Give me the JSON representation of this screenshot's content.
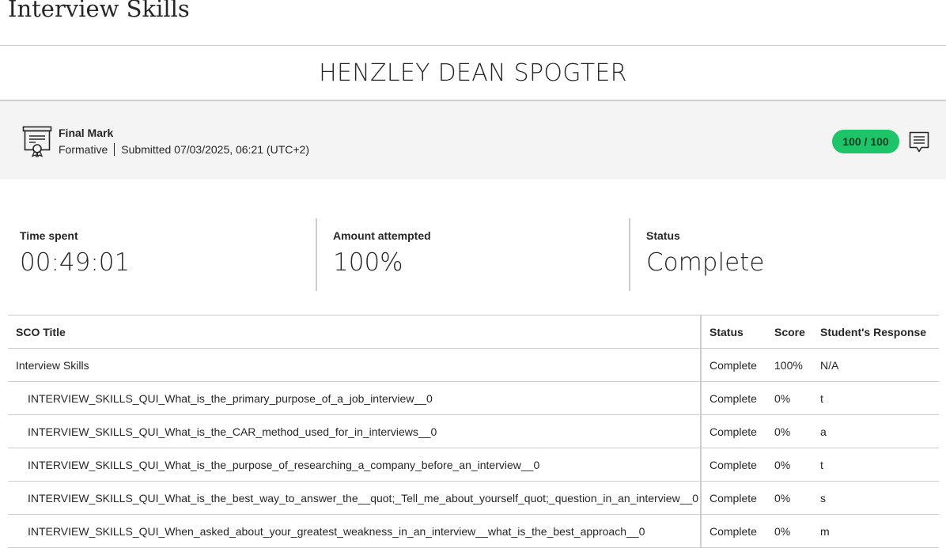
{
  "page": {
    "title": "Interview Skills"
  },
  "student": {
    "name": "HENZLEY DEAN SPOGTER"
  },
  "final_mark": {
    "label": "Final Mark",
    "type": "Formative",
    "submitted": "Submitted 07/03/2025, 06:21 (UTC+2)",
    "score": "100 / 100",
    "score_color": "#1ec568",
    "icons": [
      "certificate-icon",
      "feedback-icon"
    ]
  },
  "stats": [
    {
      "label": "Time spent",
      "value": "00:49:01"
    },
    {
      "label": "Amount attempted",
      "value": "100%"
    },
    {
      "label": "Status",
      "value": "Complete"
    }
  ],
  "table": {
    "headers": [
      "SCO Title",
      "Status",
      "Score",
      "Student's Response"
    ],
    "rows": [
      {
        "title": "Interview Skills",
        "status": "Complete",
        "score": "100%",
        "response": "N/A"
      },
      {
        "title": "INTERVIEW_SKILLS_QUI_What_is_the_primary_purpose_of_a_job_interview__0",
        "status": "Complete",
        "score": "0%",
        "response": "t"
      },
      {
        "title": "INTERVIEW_SKILLS_QUI_What_is_the_CAR_method_used_for_in_interviews__0",
        "status": "Complete",
        "score": "0%",
        "response": "a"
      },
      {
        "title": "INTERVIEW_SKILLS_QUI_What_is_the_purpose_of_researching_a_company_before_an_interview__0",
        "status": "Complete",
        "score": "0%",
        "response": "t"
      },
      {
        "title": "INTERVIEW_SKILLS_QUI_What_is_the_best_way_to_answer_the__quot;_Tell_me_about_yourself_quot;_question_in_an_interview__0",
        "status": "Complete",
        "score": "0%",
        "response": "s"
      },
      {
        "title": "INTERVIEW_SKILLS_QUI_When_asked_about_your_greatest_weakness_in_an_interview__what_is_the_best_approach__0",
        "status": "Complete",
        "score": "0%",
        "response": "m"
      }
    ]
  }
}
